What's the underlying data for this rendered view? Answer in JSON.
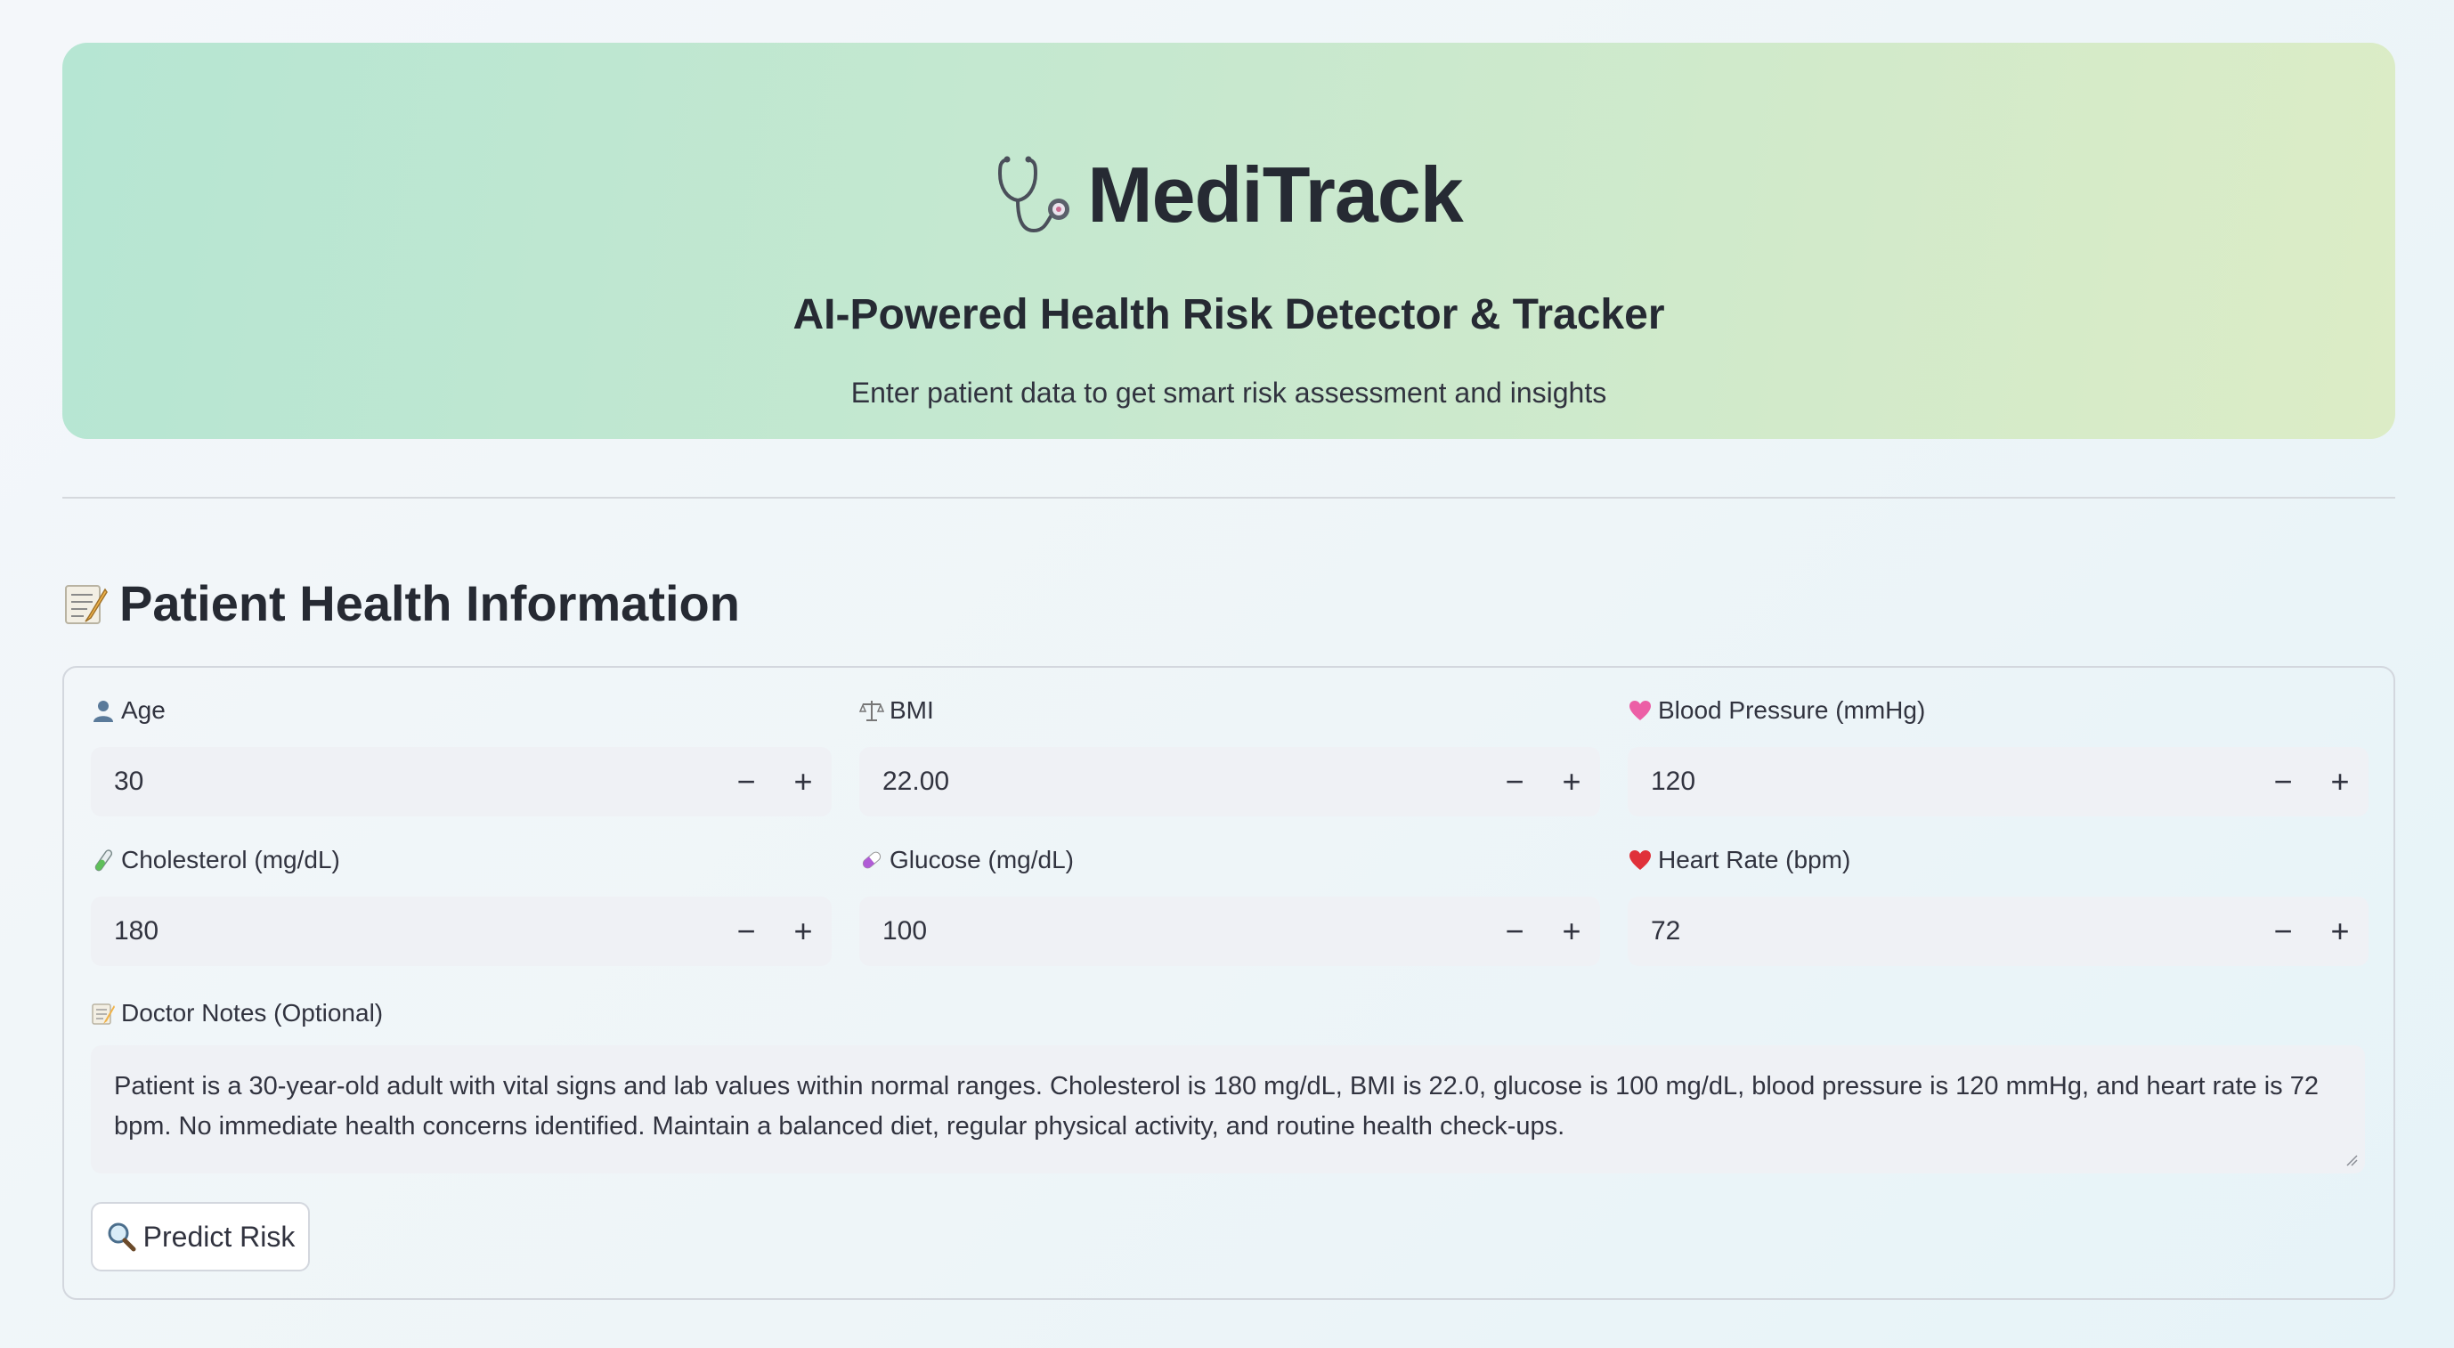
{
  "header": {
    "app_name": "MediTrack",
    "logo_icon": "stethoscope-icon",
    "subtitle": "AI-Powered Health Risk Detector & Tracker",
    "description": "Enter patient data to get smart risk assessment and insights"
  },
  "section": {
    "title": "Patient Health Information",
    "icon": "memo-icon"
  },
  "fields": {
    "age": {
      "label": "Age",
      "icon": "person-icon",
      "value": "30"
    },
    "bmi": {
      "label": "BMI",
      "icon": "scale-icon",
      "value": "22.00"
    },
    "blood_pressure": {
      "label": "Blood Pressure (mmHg)",
      "icon": "heart-icon",
      "value": "120"
    },
    "cholesterol": {
      "label": "Cholesterol (mg/dL)",
      "icon": "test-tube-icon",
      "value": "180"
    },
    "glucose": {
      "label": "Glucose (mg/dL)",
      "icon": "pill-icon",
      "value": "100"
    },
    "heart_rate": {
      "label": "Heart Rate (bpm)",
      "icon": "red-heart-icon",
      "value": "72"
    }
  },
  "stepper": {
    "minus": "−",
    "plus": "+"
  },
  "notes": {
    "label": "Doctor Notes (Optional)",
    "icon": "memo-icon",
    "value": "Patient is a 30-year-old adult with vital signs and lab values within normal ranges. Cholesterol is 180 mg/dL, BMI is 22.0, glucose is 100 mg/dL, blood pressure is 120 mmHg, and heart rate is 72 bpm. No immediate health concerns identified. Maintain a balanced diet, regular physical activity, and routine health check-ups."
  },
  "predict_button": {
    "label": "Predict Risk",
    "icon": "magnifier-icon"
  },
  "colors": {
    "hero_gradient_start": "#b6e6d3",
    "hero_gradient_end": "#dcecc6",
    "input_background": "#eff1f5",
    "text": "#31333f"
  }
}
